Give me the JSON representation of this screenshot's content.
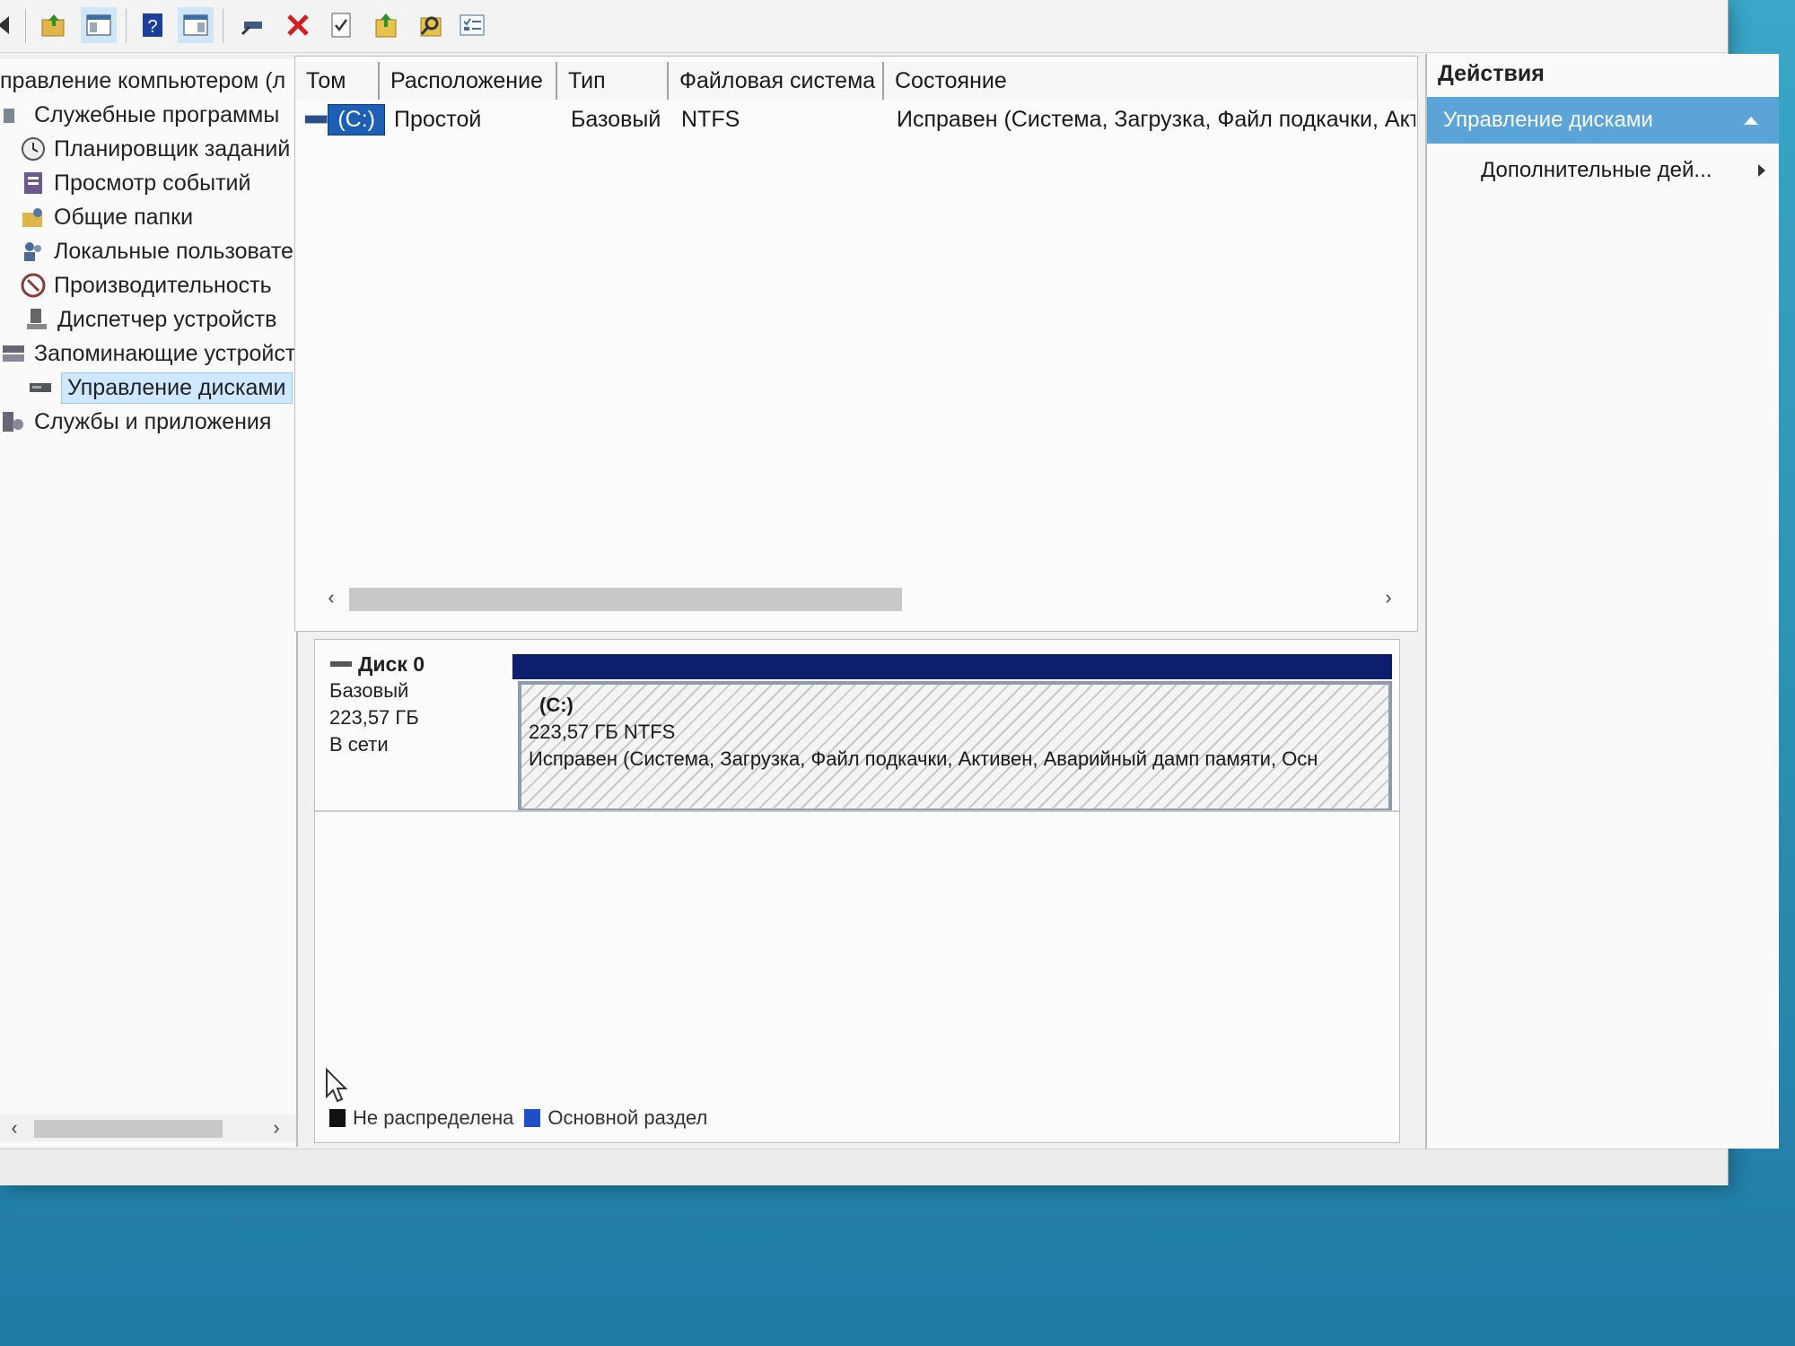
{
  "toolbar": {
    "icons": [
      "back-arrow-icon",
      "up-folder-icon",
      "show-hide-console-tree-icon",
      "help-icon",
      "properties-pane-icon",
      "connect-icon",
      "delete-icon",
      "check-icon",
      "export-icon",
      "search-icon",
      "checklist-icon"
    ]
  },
  "tree": {
    "items": [
      {
        "label": "правление компьютером (л",
        "icon": "computer-management-icon"
      },
      {
        "label": "Служебные программы",
        "icon": "tools-icon"
      },
      {
        "label": "Планировщик заданий",
        "icon": "clock-icon"
      },
      {
        "label": "Просмотр событий",
        "icon": "event-viewer-icon"
      },
      {
        "label": "Общие папки",
        "icon": "shared-folders-icon"
      },
      {
        "label": "Локальные пользовате",
        "icon": "users-icon"
      },
      {
        "label": "Производительность",
        "icon": "performance-icon"
      },
      {
        "label": "Диспетчер устройств",
        "icon": "device-manager-icon"
      },
      {
        "label": "Запоминающие устройст",
        "icon": "storage-icon"
      },
      {
        "label": "Управление дисками",
        "icon": "disk-management-icon"
      },
      {
        "label": "Службы и приложения",
        "icon": "services-icon"
      }
    ]
  },
  "volume_list": {
    "columns": [
      "Том",
      "Расположение",
      "Тип",
      "Файловая система",
      "Состояние"
    ],
    "rows": [
      {
        "volume": "(C:)",
        "layout": "Простой",
        "type": "Базовый",
        "filesystem": "NTFS",
        "status": "Исправен (Система, Загрузка, Файл подкачки, Акт"
      }
    ]
  },
  "disk": {
    "name": "Диск 0",
    "type": "Базовый",
    "size": "223,57 ГБ",
    "state": "В сети",
    "partition": {
      "label": "(C:)",
      "size_fs": "223,57 ГБ NTFS",
      "status": "Исправен (Система, Загрузка, Файл подкачки, Активен, Аварийный дамп памяти, Осн"
    }
  },
  "legend": [
    {
      "label": "Не распределена",
      "color": "#111111"
    },
    {
      "label": "Основной раздел",
      "color": "#1f4fc4"
    }
  ],
  "actions": {
    "header": "Действия",
    "section": "Управление дисками",
    "item": "Дополнительные дей..."
  },
  "colors": {
    "accent": "#5aa4d8",
    "partition_bar": "#0d1e6e",
    "selected_volume": "#1d5fb4"
  }
}
